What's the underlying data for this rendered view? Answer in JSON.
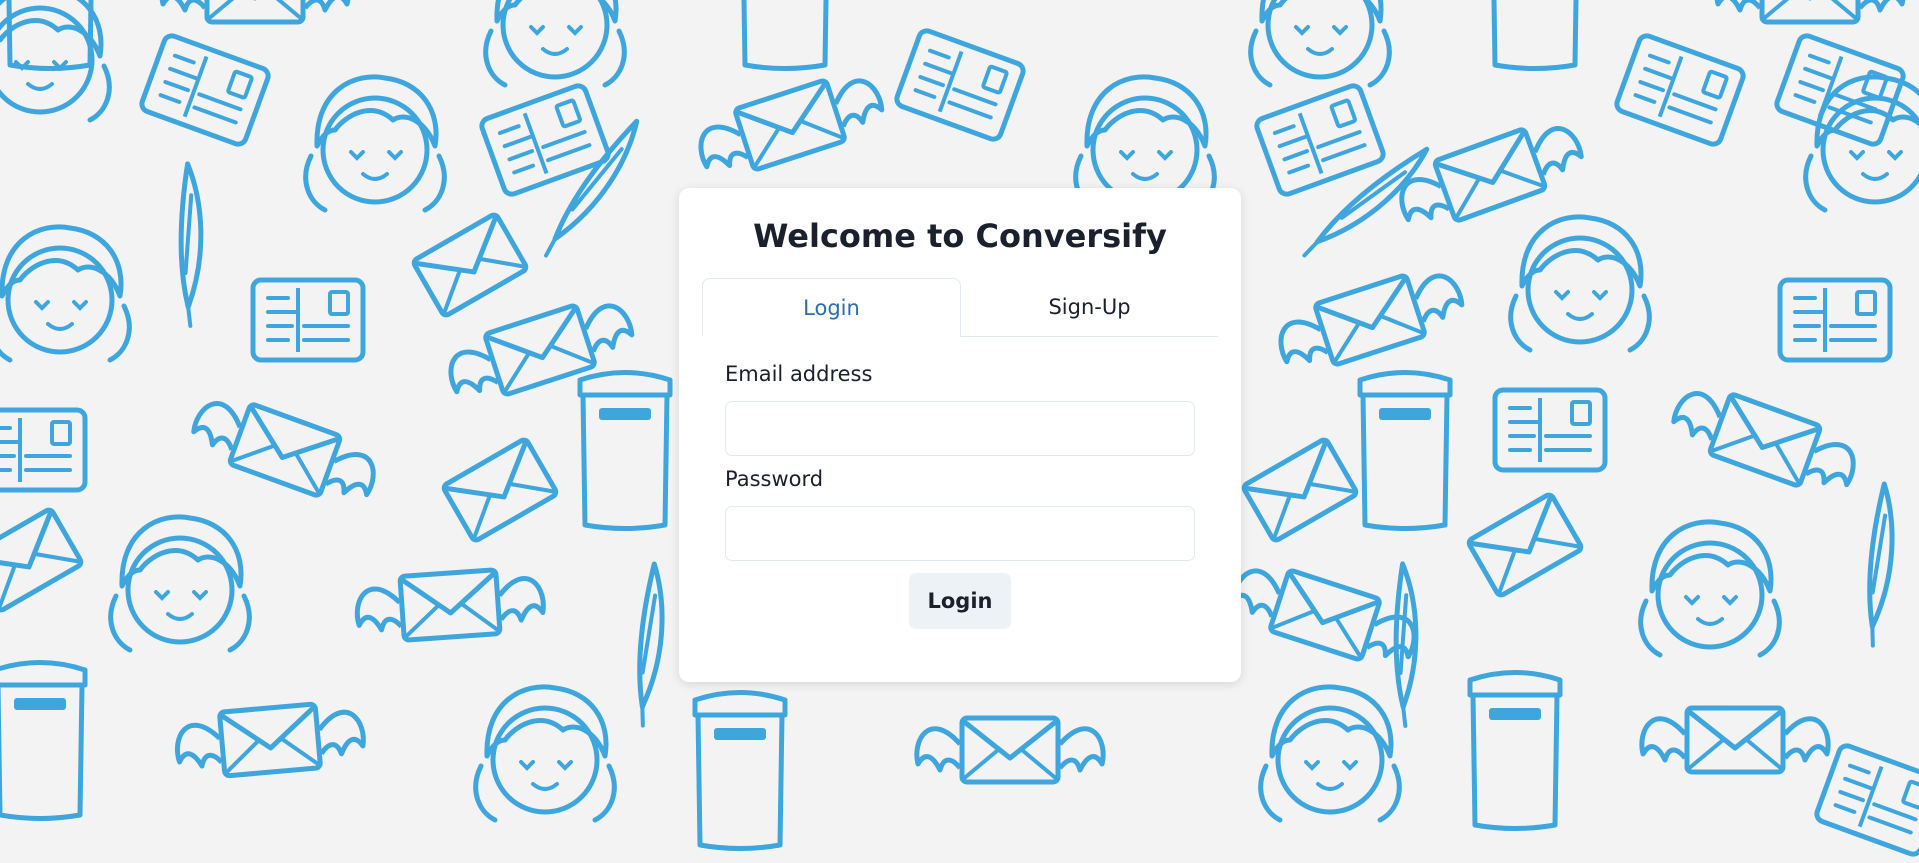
{
  "background": {
    "color": "#f3f3f3",
    "pattern_color": "#3ea6dd",
    "pattern_icons": [
      "envelope-icon",
      "winged-envelope-icon",
      "postcard-icon",
      "mailbox-icon",
      "quill-icon",
      "girl-face-icon"
    ]
  },
  "card": {
    "title": "Welcome to Conversify"
  },
  "tabs": [
    {
      "label": "Login",
      "active": true
    },
    {
      "label": "Sign-Up",
      "active": false
    }
  ],
  "form": {
    "email_label": "Email address",
    "email_value": "",
    "password_label": "Password",
    "password_value": "",
    "submit_label": "Login"
  },
  "colors": {
    "active_tab": "#2b6cb0",
    "text": "#1a202c",
    "button_bg": "#edf2f7"
  }
}
